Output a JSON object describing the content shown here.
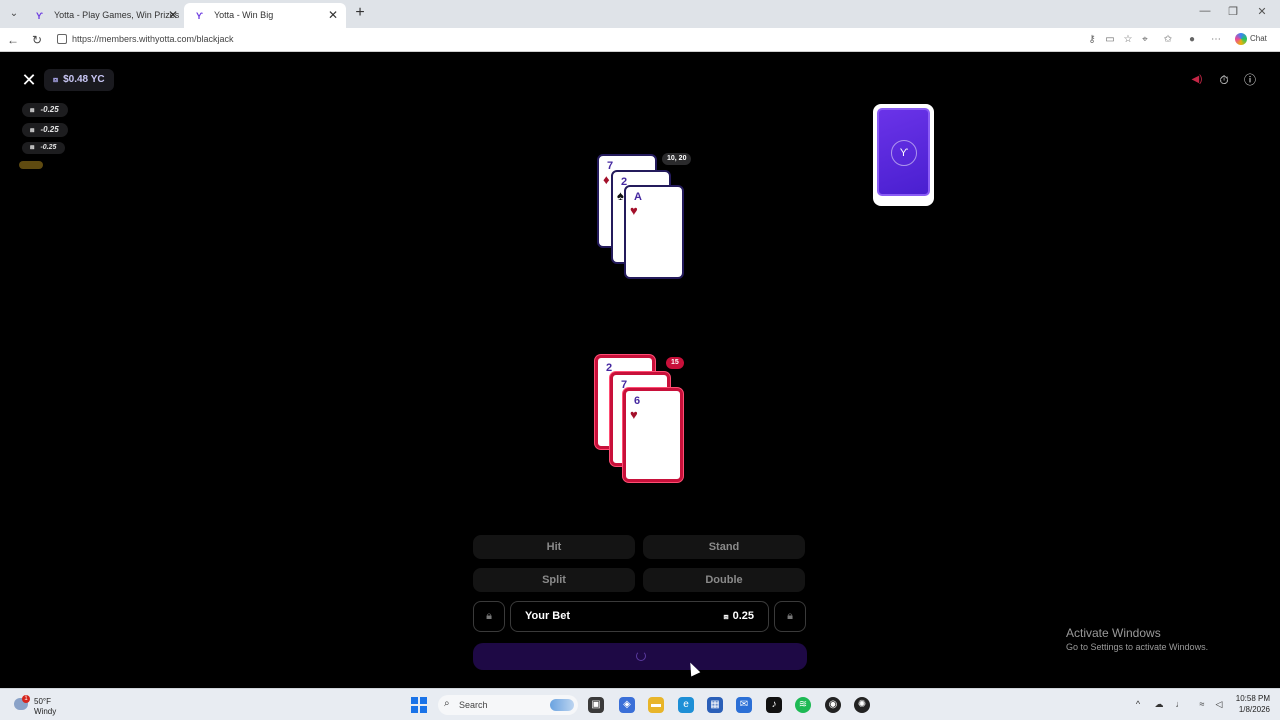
{
  "browser": {
    "tabs": [
      {
        "title": "Yotta - Play Games, Win Prizes",
        "active": false
      },
      {
        "title": "Yotta - Win Big",
        "active": true
      }
    ],
    "url": "https://members.withyotta.com/blackjack",
    "copilot_label": "Chat"
  },
  "game": {
    "balance": "$0.48 YC",
    "currency_symbol": "⧈",
    "history": [
      "-0.25",
      "-0.25",
      "-0.25"
    ],
    "dealer": {
      "score": "10, 20",
      "cards": [
        {
          "rank": "7",
          "suit": "♦",
          "color": "red"
        },
        {
          "rank": "2",
          "suit": "♠",
          "color": "black"
        },
        {
          "rank": "A",
          "suit": "♥",
          "color": "red"
        }
      ]
    },
    "player": {
      "score": "15",
      "cards": [
        {
          "rank": "2",
          "suit": "",
          "color": "red"
        },
        {
          "rank": "7",
          "suit": "",
          "color": "red"
        },
        {
          "rank": "6",
          "suit": "♥",
          "color": "red"
        }
      ]
    },
    "actions": {
      "hit": "Hit",
      "stand": "Stand",
      "split": "Split",
      "double": "Double"
    },
    "bet": {
      "label": "Your Bet",
      "amount": "0.25"
    },
    "icons": {
      "close": "close-icon",
      "sound": "speaker-muted-icon",
      "timer": "timer-icon",
      "info": "info-icon"
    },
    "colors": {
      "accent_purple": "#5a2ce0",
      "player_red": "#c8103a",
      "card_text": "#4528a0"
    }
  },
  "watermark": {
    "title": "Activate Windows",
    "subtitle": "Go to Settings to activate Windows."
  },
  "taskbar": {
    "weather_temp": "50°F",
    "weather_cond": "Windy",
    "weather_badge": "1",
    "search_placeholder": "Search",
    "time": "10:58 PM",
    "date": "1/8/2026"
  }
}
